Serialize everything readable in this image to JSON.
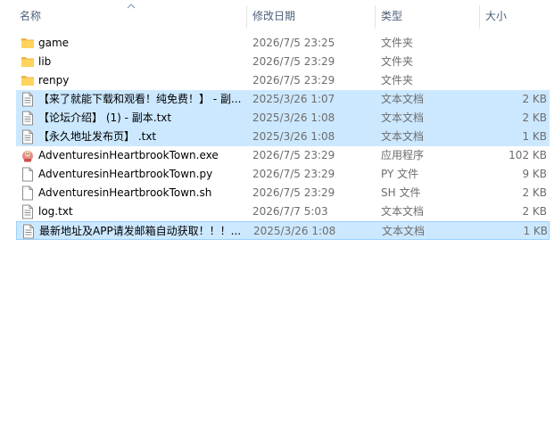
{
  "columns": {
    "name": "名称",
    "date": "修改日期",
    "type": "类型",
    "size": "大小"
  },
  "rows": [
    {
      "name": "game",
      "date": "2026/7/5 23:25",
      "type": "文件夹",
      "size": "",
      "icon": "folder-icon",
      "selected": false
    },
    {
      "name": "lib",
      "date": "2026/7/5 23:29",
      "type": "文件夹",
      "size": "",
      "icon": "folder-icon",
      "selected": false
    },
    {
      "name": "renpy",
      "date": "2026/7/5 23:29",
      "type": "文件夹",
      "size": "",
      "icon": "folder-icon",
      "selected": false
    },
    {
      "name": "【来了就能下载和观看！纯免费！】 - 副...",
      "date": "2025/3/26 1:07",
      "type": "文本文档",
      "size": "2 KB",
      "icon": "text-file-icon",
      "selected": true
    },
    {
      "name": "【论坛介绍】 (1) - 副本.txt",
      "date": "2025/3/26 1:08",
      "type": "文本文档",
      "size": "2 KB",
      "icon": "text-file-icon",
      "selected": true
    },
    {
      "name": "【永久地址发布页】 .txt",
      "date": "2025/3/26 1:08",
      "type": "文本文档",
      "size": "1 KB",
      "icon": "text-file-icon",
      "selected": true
    },
    {
      "name": "AdventuresinHeartbrookTown.exe",
      "date": "2026/7/5 23:29",
      "type": "应用程序",
      "size": "102 KB",
      "icon": "app-exe-icon",
      "selected": false
    },
    {
      "name": "AdventuresinHeartbrookTown.py",
      "date": "2026/7/5 23:29",
      "type": "PY 文件",
      "size": "9 KB",
      "icon": "blank-file-icon",
      "selected": false
    },
    {
      "name": "AdventuresinHeartbrookTown.sh",
      "date": "2026/7/5 23:29",
      "type": "SH 文件",
      "size": "2 KB",
      "icon": "blank-file-icon",
      "selected": false
    },
    {
      "name": "log.txt",
      "date": "2026/7/7 5:03",
      "type": "文本文档",
      "size": "2 KB",
      "icon": "text-file-icon",
      "selected": false
    },
    {
      "name": "最新地址及APP请发邮箱自动获取！！！...",
      "date": "2025/3/26 1:08",
      "type": "文本文档",
      "size": "1 KB",
      "icon": "text-file-icon",
      "selected": true
    }
  ]
}
